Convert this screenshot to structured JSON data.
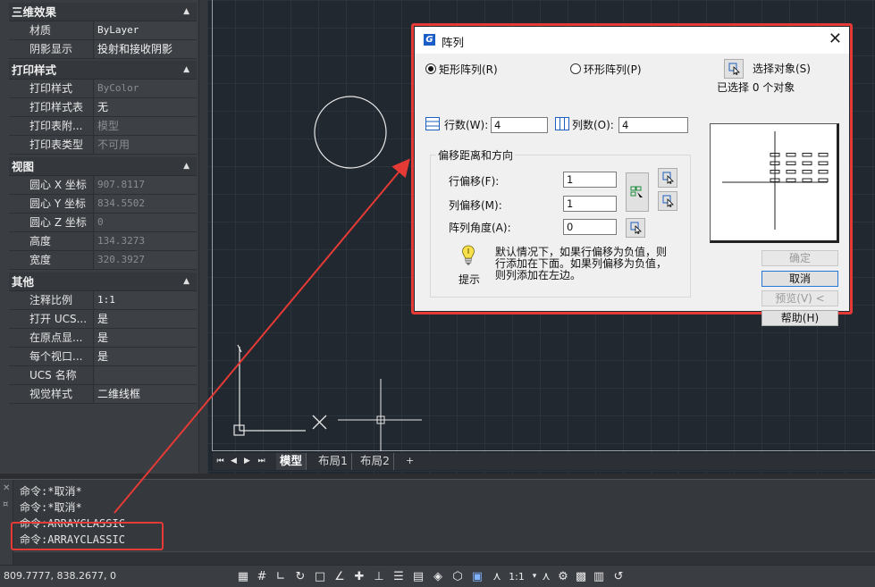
{
  "properties": {
    "sections": [
      {
        "title": "三维效果",
        "rows": [
          {
            "key": "材质",
            "value": "ByLayer"
          },
          {
            "key": "阴影显示",
            "value": "投射和接收阴影"
          }
        ]
      },
      {
        "title": "打印样式",
        "rows": [
          {
            "key": "打印样式",
            "value": "ByColor"
          },
          {
            "key": "打印样式表",
            "value": "无"
          },
          {
            "key": "打印表附...",
            "value": "模型"
          },
          {
            "key": "打印表类型",
            "value": "不可用"
          }
        ]
      },
      {
        "title": "视图",
        "rows": [
          {
            "key": "圆心 X 坐标",
            "value": "907.8117"
          },
          {
            "key": "圆心 Y 坐标",
            "value": "834.5502"
          },
          {
            "key": "圆心 Z 坐标",
            "value": "0"
          },
          {
            "key": "高度",
            "value": "134.3273"
          },
          {
            "key": "宽度",
            "value": "320.3927"
          }
        ]
      },
      {
        "title": "其他",
        "rows": [
          {
            "key": "注释比例",
            "value": "1:1"
          },
          {
            "key": "打开 UCS...",
            "value": "是"
          },
          {
            "key": "在原点显...",
            "value": "是"
          },
          {
            "key": "每个视口...",
            "value": "是"
          },
          {
            "key": "UCS 名称",
            "value": ""
          },
          {
            "key": "视觉样式",
            "value": "二维线框"
          }
        ]
      }
    ]
  },
  "layout_tabs": {
    "nav": [
      "⏮",
      "◀",
      "▶",
      "⏭"
    ],
    "tabs": [
      "模型",
      "布局1",
      "布局2"
    ],
    "add": "+"
  },
  "command": {
    "lines": [
      "命令:*取消*",
      "命令:*取消*",
      "命令:ARRAYCLASSIC",
      "命令:ARRAYCLASSIC"
    ],
    "gutter": [
      "✕",
      "¤"
    ]
  },
  "status": {
    "coords": "809.7777, 838.2677, 0",
    "scale": "1:1"
  },
  "dialog": {
    "logo": "G",
    "title": "阵列",
    "close": "✕",
    "rect_option": "矩形阵列(R)",
    "polar_option": "环形阵列(P)",
    "select_objects": "选择对象(S)",
    "selected_count": "已选择 0 个对象",
    "rows_label": "行数(W):",
    "rows_value": "4",
    "cols_label": "列数(O):",
    "cols_value": "4",
    "offset_group": "偏移距离和方向",
    "row_offset_label": "行偏移(F):",
    "row_offset_value": "1",
    "col_offset_label": "列偏移(M):",
    "col_offset_value": "1",
    "angle_label": "阵列角度(A):",
    "angle_value": "0",
    "tip_label": "提示",
    "tip_text_1": "默认情况下，如果行偏移为负值，则",
    "tip_text_2": "行添加在下面。如果列偏移为负值，",
    "tip_text_3": "则列添加在左边。",
    "ok": "确定",
    "cancel": "取消",
    "preview": "预览(V) <",
    "help": "帮助(H)"
  },
  "colors": {
    "annotation": "#e53a35",
    "canvas": "#212830",
    "dialog_bg": "#f0f0f0"
  }
}
